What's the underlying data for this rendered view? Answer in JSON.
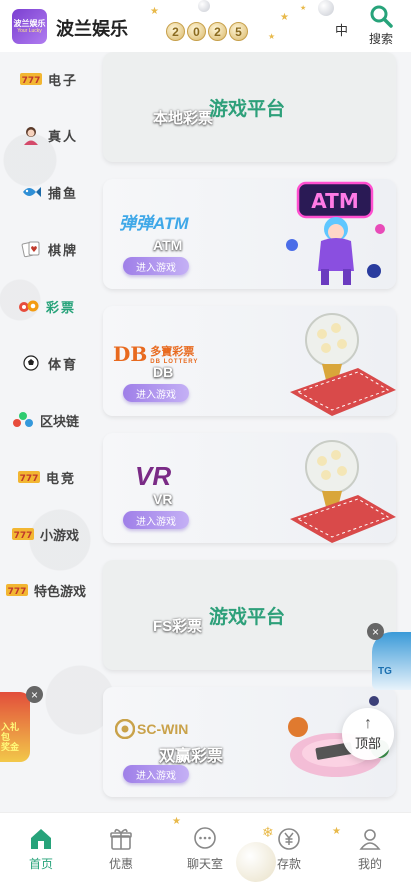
{
  "header": {
    "logo_text_1": "波兰娱乐",
    "logo_text_2": "Your Lucky",
    "title": "波兰娱乐",
    "deco_year": [
      "2",
      "0",
      "2",
      "5"
    ],
    "lang": "中",
    "search_label": "搜索"
  },
  "sidebar": {
    "items": [
      {
        "label": "电子",
        "icon": "slot-777-icon"
      },
      {
        "label": "真人",
        "icon": "live-dealer-icon"
      },
      {
        "label": "捕鱼",
        "icon": "fish-icon"
      },
      {
        "label": "棋牌",
        "icon": "cards-icon"
      },
      {
        "label": "彩票",
        "icon": "lottery-icon",
        "active": true
      },
      {
        "label": "体育",
        "icon": "soccer-ball-icon"
      },
      {
        "label": "区块链",
        "icon": "blockchain-icon"
      },
      {
        "label": "电竞",
        "icon": "esports-icon"
      },
      {
        "label": "小游戏",
        "icon": "minigame-icon"
      },
      {
        "label": "特色游戏",
        "icon": "feature-game-icon"
      }
    ]
  },
  "cards": [
    {
      "type": "placeholder",
      "sub": "本地彩票",
      "main": "游戏平台"
    },
    {
      "type": "brand",
      "logo": "弹弹ATM",
      "name": "ATM",
      "button": "进入游戏"
    },
    {
      "type": "brand",
      "logo": "多寶彩票",
      "logo_sub": "DB LOTTERY",
      "logo_prefix": "DB",
      "name": "DB",
      "button": "进入游戏"
    },
    {
      "type": "brand",
      "logo": "VR",
      "name": "VR",
      "button": "进入游戏"
    },
    {
      "type": "placeholder",
      "sub": "FS彩票",
      "main": "游戏平台"
    },
    {
      "type": "brand",
      "logo": "SC-WIN",
      "name": "双赢彩票",
      "button": "进入游戏"
    }
  ],
  "floating": {
    "left_promo_text": "入礼\n包\n奖金",
    "right_promo_text": "TG",
    "close_glyph": "×",
    "back_top_arrow": "↑",
    "back_top_label": "顶部"
  },
  "tabbar": {
    "tabs": [
      {
        "label": "首页",
        "icon": "home-icon",
        "active": true
      },
      {
        "label": "优惠",
        "icon": "gift-icon"
      },
      {
        "label": "聊天室",
        "icon": "chat-icon"
      },
      {
        "label": "存款",
        "icon": "yuan-icon"
      },
      {
        "label": "我的",
        "icon": "user-icon"
      }
    ]
  },
  "colors": {
    "accent": "#27a37a",
    "button_purple": "#a98cec",
    "background": "#f2f3f5"
  }
}
